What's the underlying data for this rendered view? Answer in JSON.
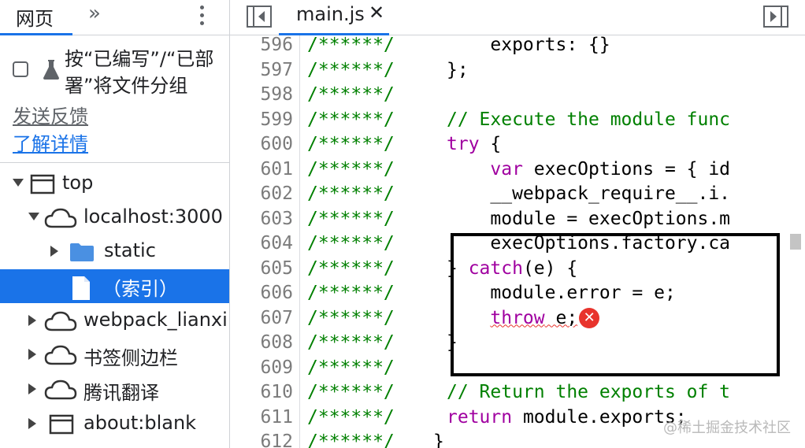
{
  "left_panel": {
    "tab_label": "网页",
    "more_tabs_glyph": "»",
    "group_by_authored": {
      "checked": false,
      "label": "按“已编写”/“已部署”将文件分组"
    },
    "send_feedback": "发送反馈",
    "learn_more": "了解详情",
    "tree": [
      {
        "label": "top",
        "icon": "window-icon",
        "expanded": true
      },
      {
        "label": "localhost:3000",
        "icon": "cloud-icon",
        "expanded": true
      },
      {
        "label": "static",
        "icon": "folder-icon",
        "expanded": false
      },
      {
        "label": "（索引）",
        "icon": "file-icon",
        "selected": true
      },
      {
        "label": "webpack_lianxi",
        "icon": "cloud-icon",
        "expanded": false
      },
      {
        "label": "书签侧边栏",
        "icon": "cloud-icon",
        "expanded": false
      },
      {
        "label": "腾讯翻译",
        "icon": "cloud-icon",
        "expanded": false
      },
      {
        "label": "about:blank",
        "icon": "window-icon",
        "expanded": false
      }
    ]
  },
  "editor": {
    "file_tab": "main.js",
    "close_glyph": "✕",
    "gutter_comment": "/******/",
    "lines": [
      {
        "n": "596",
        "text": "        exports: {}"
      },
      {
        "n": "597",
        "text": "    };"
      },
      {
        "n": "598",
        "text": ""
      },
      {
        "n": "599",
        "text": "    // Execute the module func"
      },
      {
        "n": "600",
        "text": "    try {"
      },
      {
        "n": "601",
        "text": "        var execOptions = { id"
      },
      {
        "n": "602",
        "text": "        __webpack_require__.i."
      },
      {
        "n": "603",
        "text": "        module = execOptions.m"
      },
      {
        "n": "604",
        "text": "        execOptions.factory.ca"
      },
      {
        "n": "605",
        "text": "    } catch(e) {"
      },
      {
        "n": "606",
        "text": "        module.error = e;"
      },
      {
        "n": "607",
        "text": "        throw e;"
      },
      {
        "n": "608",
        "text": "    }"
      },
      {
        "n": "609",
        "text": ""
      },
      {
        "n": "610",
        "text": "    // Return the exports of t"
      },
      {
        "n": "611",
        "text": "    return module.exports;"
      },
      {
        "n": "612",
        "text": "}"
      }
    ],
    "error_glyph": "✕"
  },
  "watermark": "@稀土掘金技术社区",
  "colors": {
    "accent": "#1a73e8",
    "keyword": "#a000a0",
    "comment": "#008000",
    "error": "#e8332c"
  }
}
